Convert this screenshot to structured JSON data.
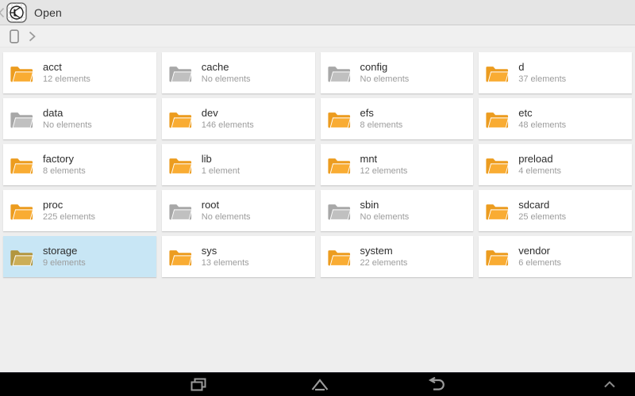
{
  "header": {
    "back_glyph": "caret-left",
    "title": "Open",
    "app_icon": "circuit-logo"
  },
  "breadcrumb": {
    "device_icon": "tablet-device",
    "chevron_icon": "chevron-right"
  },
  "folders": [
    {
      "name": "acct",
      "count_label": "12 elements",
      "state": "filled"
    },
    {
      "name": "cache",
      "count_label": "No elements",
      "state": "empty"
    },
    {
      "name": "config",
      "count_label": "No elements",
      "state": "empty"
    },
    {
      "name": "d",
      "count_label": "37 elements",
      "state": "filled"
    },
    {
      "name": "data",
      "count_label": "No elements",
      "state": "empty"
    },
    {
      "name": "dev",
      "count_label": "146 elements",
      "state": "filled"
    },
    {
      "name": "efs",
      "count_label": "8 elements",
      "state": "filled"
    },
    {
      "name": "etc",
      "count_label": "48 elements",
      "state": "filled"
    },
    {
      "name": "factory",
      "count_label": "8 elements",
      "state": "filled"
    },
    {
      "name": "lib",
      "count_label": "1 element",
      "state": "filled"
    },
    {
      "name": "mnt",
      "count_label": "12 elements",
      "state": "filled"
    },
    {
      "name": "preload",
      "count_label": "4 elements",
      "state": "filled"
    },
    {
      "name": "proc",
      "count_label": "225 elements",
      "state": "filled"
    },
    {
      "name": "root",
      "count_label": "No elements",
      "state": "empty"
    },
    {
      "name": "sbin",
      "count_label": "No elements",
      "state": "empty"
    },
    {
      "name": "sdcard",
      "count_label": "25 elements",
      "state": "filled"
    },
    {
      "name": "storage",
      "count_label": "9 elements",
      "state": "selected"
    },
    {
      "name": "sys",
      "count_label": "13 elements",
      "state": "filled"
    },
    {
      "name": "system",
      "count_label": "22 elements",
      "state": "filled"
    },
    {
      "name": "vendor",
      "count_label": "6 elements",
      "state": "filled"
    }
  ],
  "navbar": {
    "icons": [
      "recent-apps",
      "home",
      "back",
      "hide-navbar"
    ]
  },
  "colors": {
    "folder_orange": "#F4A426",
    "folder_gray": "#B5B5B5",
    "selection_blue": "#C8E6F5",
    "actionbar_bg": "#E5E5E5",
    "content_bg": "#EEEEEE",
    "navbar_bg": "#000000"
  }
}
